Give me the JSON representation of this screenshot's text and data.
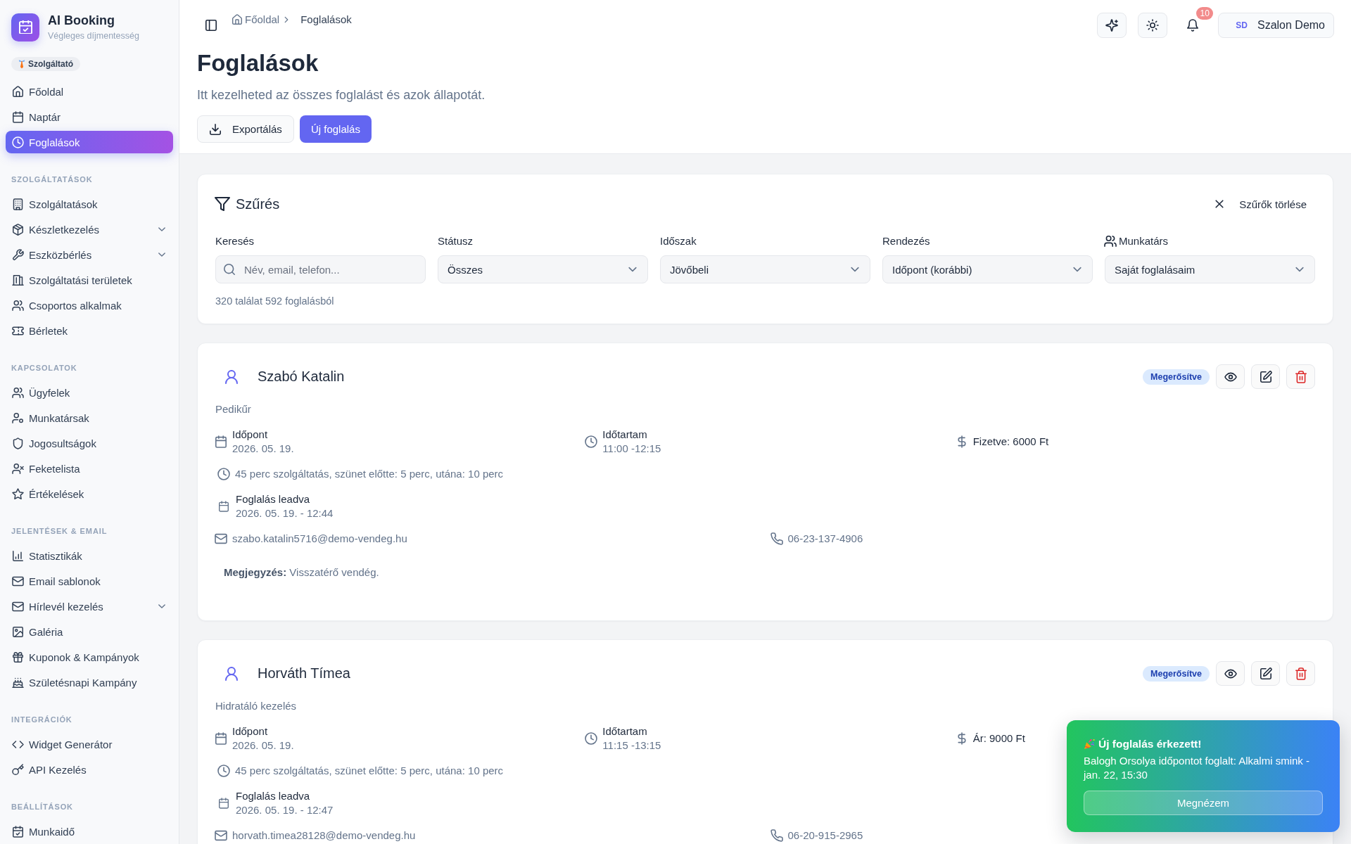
{
  "sidebar": {
    "brand": {
      "title": "AI Booking",
      "subtitle": "Végleges díjmentesség"
    },
    "role_badge": "Szolgáltató",
    "main_items": [
      {
        "label": "Főoldal",
        "selected": false,
        "expandable": false
      },
      {
        "label": "Naptár",
        "selected": false,
        "expandable": false
      },
      {
        "label": "Foglalások",
        "selected": true,
        "expandable": false
      }
    ],
    "sections": [
      {
        "heading": "SZOLGÁLTATÁSOK",
        "items": [
          {
            "label": "Szolgáltatások",
            "selected": false,
            "expandable": false
          },
          {
            "label": "Készletkezelés",
            "selected": false,
            "expandable": true
          },
          {
            "label": "Eszközbérlés",
            "selected": false,
            "expandable": true
          },
          {
            "label": "Szolgáltatási területek",
            "selected": false,
            "expandable": false
          },
          {
            "label": "Csoportos alkalmak",
            "selected": false,
            "expandable": false
          },
          {
            "label": "Bérletek",
            "selected": false,
            "expandable": false
          }
        ]
      },
      {
        "heading": "KAPCSOLATOK",
        "items": [
          {
            "label": "Ügyfelek",
            "selected": false,
            "expandable": false
          },
          {
            "label": "Munkatársak",
            "selected": false,
            "expandable": false
          },
          {
            "label": "Jogosultságok",
            "selected": false,
            "expandable": false
          },
          {
            "label": "Feketelista",
            "selected": false,
            "expandable": false
          },
          {
            "label": "Értékelések",
            "selected": false,
            "expandable": false
          }
        ]
      },
      {
        "heading": "JELENTÉSEK & EMAIL",
        "items": [
          {
            "label": "Statisztikák",
            "selected": false,
            "expandable": false
          },
          {
            "label": "Email sablonok",
            "selected": false,
            "expandable": false
          },
          {
            "label": "Hírlevél kezelés",
            "selected": false,
            "expandable": true
          },
          {
            "label": "Galéria",
            "selected": false,
            "expandable": false
          },
          {
            "label": "Kuponok & Kampányok",
            "selected": false,
            "expandable": false
          },
          {
            "label": "Születésnapi Kampány",
            "selected": false,
            "expandable": false
          }
        ]
      },
      {
        "heading": "INTEGRÁCIÓK",
        "items": [
          {
            "label": "Widget Generátor",
            "selected": false,
            "expandable": false
          },
          {
            "label": "API Kezelés",
            "selected": false,
            "expandable": false
          }
        ]
      },
      {
        "heading": "BEÁLLÍTÁSOK",
        "items": [
          {
            "label": "Munkaidő",
            "selected": false,
            "expandable": false
          }
        ]
      }
    ]
  },
  "header": {
    "breadcrumb": [
      "Főoldal",
      "Foglalások"
    ],
    "notification_count": "10",
    "user": {
      "initials": "SD",
      "name": "Szalon Demo"
    }
  },
  "page": {
    "title": "Foglalások",
    "subtitle": "Itt kezelheted az összes foglalást és azok állapotát.",
    "actions": [
      {
        "label": "Exportálás",
        "kind": "export"
      },
      {
        "label": "Új foglalás",
        "kind": "primary"
      }
    ]
  },
  "filters": {
    "title": "Szűrés",
    "clear": "Szűrők törlése",
    "fields": [
      {
        "label": "Keresés",
        "kind": "search",
        "placeholder": "Név, email, telefon..."
      },
      {
        "label": "Státusz",
        "kind": "select",
        "value": "Összes"
      },
      {
        "label": "Időszak",
        "kind": "select",
        "value": "Jövőbeli"
      },
      {
        "label": "Rendezés",
        "kind": "select",
        "value": "Időpont (korábbi)"
      },
      {
        "label": "Munkatárs",
        "kind": "staff",
        "value": "Saját foglalásaim"
      }
    ],
    "result_count": "320 találat 592 foglalásból"
  },
  "bookings": [
    {
      "name": "Szabó Katalin",
      "status": "Megerősítve",
      "service": "Pedikűr",
      "date": {
        "label": "Időpont",
        "value": "2026. 05. 19."
      },
      "duration": {
        "label": "Időtartam",
        "value": "11:00 -12:15"
      },
      "payment": "Fizetve: 6000 Ft",
      "timing": "45 perc szolgáltatás, szünet előtte: 5 perc, utána: 10 perc",
      "placed": {
        "label": "Foglalás leadva",
        "value": "2026. 05. 19. - 12:44"
      },
      "email": "szabo.katalin5716@demo-vendeg.hu",
      "phone": "06-23-137-4906",
      "note": "**Megjegyzés:** Visszatérő vendég."
    },
    {
      "name": "Horváth Tímea",
      "status": "Megerősítve",
      "service": "Hidratáló kezelés",
      "date": {
        "label": "Időpont",
        "value": "2026. 05. 19."
      },
      "duration": {
        "label": "Időtartam",
        "value": "11:15 -13:15"
      },
      "payment": "Ár: 9000 Ft",
      "timing": "45 perc szolgáltatás, szünet előtte: 5 perc, utána: 10 perc",
      "placed": {
        "label": "Foglalás leadva",
        "value": "2026. 05. 19. - 12:47"
      },
      "email": "horvath.timea28128@demo-vendeg.hu",
      "phone": "06-20-915-2965"
    }
  ],
  "toast": {
    "title": "Új foglalás érkezett!",
    "message": "Balogh Orsolya időpontot foglalt: Alkalmi smink - jan. 22, 15:30",
    "button": "Megnézem"
  }
}
